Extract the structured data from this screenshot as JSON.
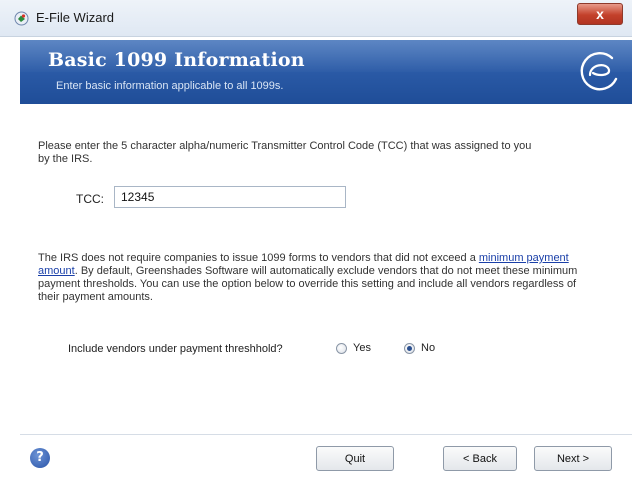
{
  "window": {
    "title": "E-File Wizard",
    "close_glyph": "x"
  },
  "banner": {
    "title": "Basic 1099 Information",
    "subtitle": "Enter basic information applicable to all 1099s.",
    "logo_icon": "greenshades-logo-icon"
  },
  "body": {
    "tcc_instruction": "Please enter the 5 character alpha/numeric Transmitter Control Code (TCC) that was assigned to you by the IRS.",
    "tcc_label": "TCC:",
    "tcc_value": "12345",
    "info_before_link": "The IRS does not require companies to issue 1099 forms to vendors that did not exceed a ",
    "info_link": "minimum payment amount",
    "info_after_link": ". By default, Greenshades Software will automatically exclude vendors that do not meet these minimum payment thresholds. You can use the option below to override this setting and include all vendors regardless of their payment amounts.",
    "include_label": "Include vendors under payment threshhold?",
    "options": [
      {
        "label": "Yes",
        "selected": false
      },
      {
        "label": "No",
        "selected": true
      }
    ]
  },
  "footer": {
    "help_icon": "help-icon",
    "quit_label": "Quit",
    "back_label": "< Back",
    "next_label": "Next >"
  },
  "colors": {
    "banner": "#2a5aa6",
    "link": "#1a3fa8",
    "close": "#c3412b"
  }
}
